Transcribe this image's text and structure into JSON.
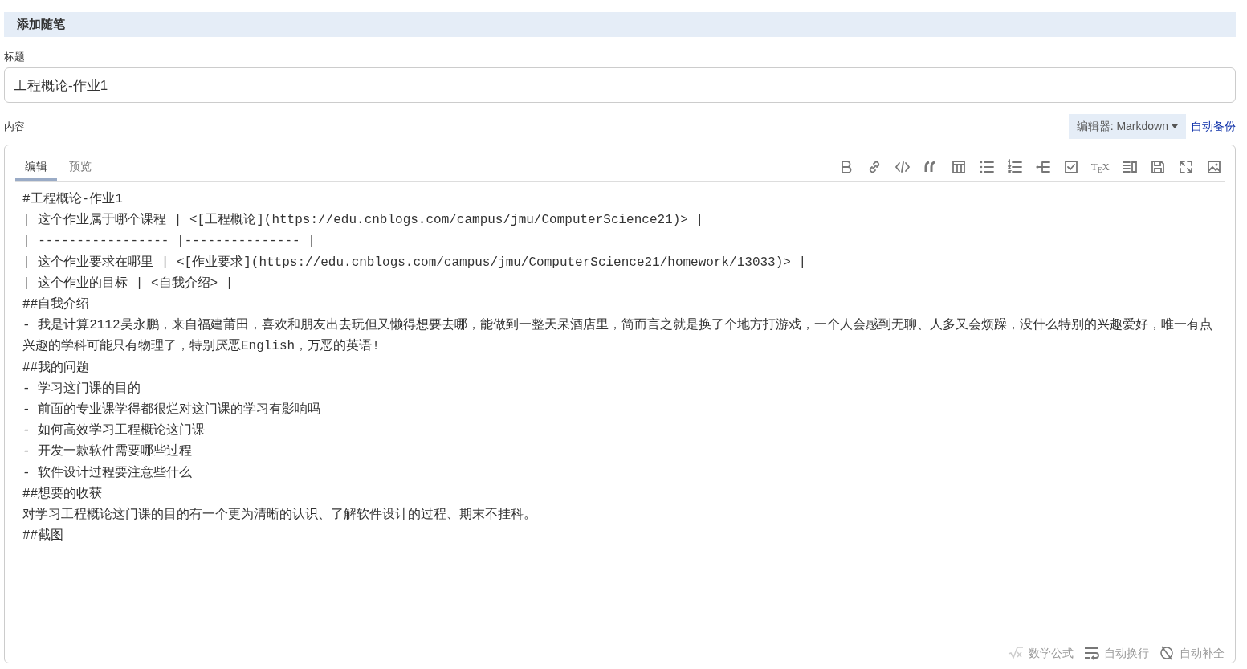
{
  "header": {
    "title": "添加随笔"
  },
  "title_field": {
    "label": "标题",
    "value": "工程概论-作业1"
  },
  "content": {
    "label": "内容",
    "editor_select": "编辑器: Markdown",
    "autosave_link": "自动备份"
  },
  "tabs": [
    {
      "label": "编辑",
      "selected": true
    },
    {
      "label": "预览",
      "selected": false
    }
  ],
  "toolbar": [
    {
      "kind": "bold"
    },
    {
      "kind": "link"
    },
    {
      "kind": "code"
    },
    {
      "kind": "quote"
    },
    {
      "kind": "table"
    },
    {
      "kind": "bullets"
    },
    {
      "kind": "numbers"
    },
    {
      "kind": "indent"
    },
    {
      "kind": "checkbox"
    },
    {
      "kind": "tex",
      "label": "T$_{E}$X"
    },
    {
      "kind": "columns"
    },
    {
      "kind": "save"
    },
    {
      "kind": "fullscreen"
    },
    {
      "kind": "image"
    }
  ],
  "editor_lines": [
    "#工程概论-作业1",
    "| 这个作业属于哪个课程 | <[工程概论](https://edu.cnblogs.com/campus/jmu/ComputerScience21)> |",
    "| ----------------- |--------------- |",
    "| 这个作业要求在哪里 | <[作业要求](https://edu.cnblogs.com/campus/jmu/ComputerScience21/homework/13033)> |",
    "| 这个作业的目标 | <自我介绍> |",
    "##自我介绍",
    "- 我是计算2112吴永鹏，来自福建莆田，喜欢和朋友出去玩但又懒得想要去哪，能做到一整天呆酒店里，简而言之就是换了个地方打游戏，一个人会感到无聊、人多又会烦躁，没什么特别的兴趣爱好，唯一有点兴趣的学科可能只有物理了，特别厌恶English，万恶的英语!",
    "##我的问题",
    "- 学习这门课的目的",
    "- 前面的专业课学得都很烂对这门课的学习有影响吗",
    "- 如何高效学习工程概论这门课",
    "- 开发一款软件需要哪些过程",
    "- 软件设计过程要注意些什么",
    "##想要的收获",
    "对学习工程概论这门课的目的有一个更为清晰的认识、了解软件设计的过程、期末不挂科。",
    "##截图"
  ],
  "status_items": [
    {
      "kind": "formula",
      "label": "数学公式"
    },
    {
      "kind": "wrap",
      "label": "自动换行"
    },
    {
      "kind": "autocomplete",
      "label": "自动补全"
    }
  ]
}
